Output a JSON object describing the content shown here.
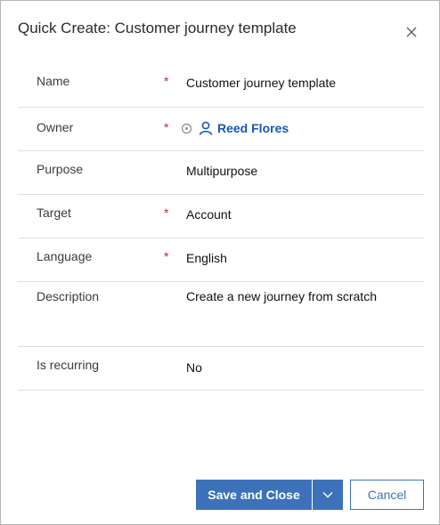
{
  "dialog": {
    "title": "Quick Create: Customer journey template"
  },
  "fields": {
    "name": {
      "label": "Name",
      "required_mark": "*",
      "value": "Customer journey template"
    },
    "owner": {
      "label": "Owner",
      "required_mark": "*",
      "value": "Reed Flores",
      "lock_icon": "lock-icon",
      "person_icon": "person-icon"
    },
    "purpose": {
      "label": "Purpose",
      "value": "Multipurpose"
    },
    "target": {
      "label": "Target",
      "required_mark": "*",
      "value": "Account"
    },
    "language": {
      "label": "Language",
      "required_mark": "*",
      "value": "English"
    },
    "description": {
      "label": "Description",
      "value": "Create a new journey from scratch"
    },
    "is_recurring": {
      "label": "Is recurring",
      "value": "No"
    }
  },
  "footer": {
    "save_label": "Save and Close",
    "cancel_label": "Cancel"
  },
  "colors": {
    "accent": "#3d72ba",
    "link": "#1557b6",
    "required": "#c4262e",
    "divider": "#e1dfdd"
  }
}
